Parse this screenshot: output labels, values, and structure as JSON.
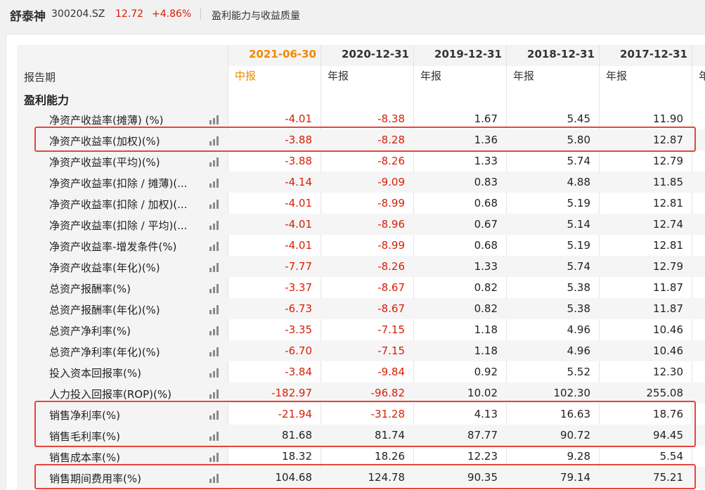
{
  "header": {
    "stock_name": "舒泰神",
    "stock_code": "300204.SZ",
    "price": "12.72",
    "change_pct": "+4.86%",
    "section": "盈利能力与收益质量",
    "price_color": "#d81e06"
  },
  "table": {
    "period_label": "报告期",
    "group_label": "盈利能力",
    "columns": [
      {
        "date": "2021-06-30",
        "type": "中报",
        "active": true
      },
      {
        "date": "2020-12-31",
        "type": "年报",
        "active": false
      },
      {
        "date": "2019-12-31",
        "type": "年报",
        "active": false
      },
      {
        "date": "2018-12-31",
        "type": "年报",
        "active": false
      },
      {
        "date": "2017-12-31",
        "type": "年报",
        "active": false
      },
      {
        "date": "",
        "type": "年",
        "active": false
      }
    ],
    "rows": [
      {
        "label": "净资产收益率(摊薄) (%)",
        "values": [
          "-4.01",
          "-8.38",
          "1.67",
          "5.45",
          "11.90"
        ]
      },
      {
        "label": "净资产收益率(加权)(%)",
        "values": [
          "-3.88",
          "-8.28",
          "1.36",
          "5.80",
          "12.87"
        ]
      },
      {
        "label": "净资产收益率(平均)(%)",
        "values": [
          "-3.88",
          "-8.26",
          "1.33",
          "5.74",
          "12.79"
        ]
      },
      {
        "label": "净资产收益率(扣除 / 摊薄)(...",
        "values": [
          "-4.14",
          "-9.09",
          "0.83",
          "4.88",
          "11.85"
        ]
      },
      {
        "label": "净资产收益率(扣除 / 加权)(...",
        "values": [
          "-4.01",
          "-8.99",
          "0.68",
          "5.19",
          "12.81"
        ]
      },
      {
        "label": "净资产收益率(扣除 / 平均)(...",
        "values": [
          "-4.01",
          "-8.96",
          "0.67",
          "5.14",
          "12.74"
        ]
      },
      {
        "label": "净资产收益率-增发条件(%)",
        "values": [
          "-4.01",
          "-8.99",
          "0.68",
          "5.19",
          "12.81"
        ]
      },
      {
        "label": "净资产收益率(年化)(%)",
        "values": [
          "-7.77",
          "-8.26",
          "1.33",
          "5.74",
          "12.79"
        ]
      },
      {
        "label": "总资产报酬率(%)",
        "values": [
          "-3.37",
          "-8.67",
          "0.82",
          "5.38",
          "11.87"
        ]
      },
      {
        "label": "总资产报酬率(年化)(%)",
        "values": [
          "-6.73",
          "-8.67",
          "0.82",
          "5.38",
          "11.87"
        ]
      },
      {
        "label": "总资产净利率(%)",
        "values": [
          "-3.35",
          "-7.15",
          "1.18",
          "4.96",
          "10.46"
        ]
      },
      {
        "label": "总资产净利率(年化)(%)",
        "values": [
          "-6.70",
          "-7.15",
          "1.18",
          "4.96",
          "10.46"
        ]
      },
      {
        "label": "投入资本回报率(%)",
        "values": [
          "-3.84",
          "-9.84",
          "0.92",
          "5.52",
          "12.30"
        ]
      },
      {
        "label": "人力投入回报率(ROP)(%)",
        "values": [
          "-182.97",
          "-96.82",
          "10.02",
          "102.30",
          "255.08"
        ]
      },
      {
        "label": "销售净利率(%)",
        "values": [
          "-21.94",
          "-31.28",
          "4.13",
          "16.63",
          "18.76"
        ]
      },
      {
        "label": "销售毛利率(%)",
        "values": [
          "81.68",
          "81.74",
          "87.77",
          "90.72",
          "94.45"
        ]
      },
      {
        "label": "销售成本率(%)",
        "values": [
          "18.32",
          "18.26",
          "12.23",
          "9.28",
          "5.54"
        ]
      },
      {
        "label": "销售期间费用率(%)",
        "values": [
          "104.68",
          "124.78",
          "90.35",
          "79.14",
          "75.21"
        ]
      }
    ],
    "highlights": [
      "净资产收益率(加权)(%)",
      "销售净利率(%) + 销售毛利率(%)",
      "销售期间费用率(%)"
    ],
    "highlight_color": "#e8453c",
    "active_color": "#f08a00",
    "negative_color": "#d81e06"
  },
  "icons": {
    "row_icon": "bar-chart-icon"
  }
}
